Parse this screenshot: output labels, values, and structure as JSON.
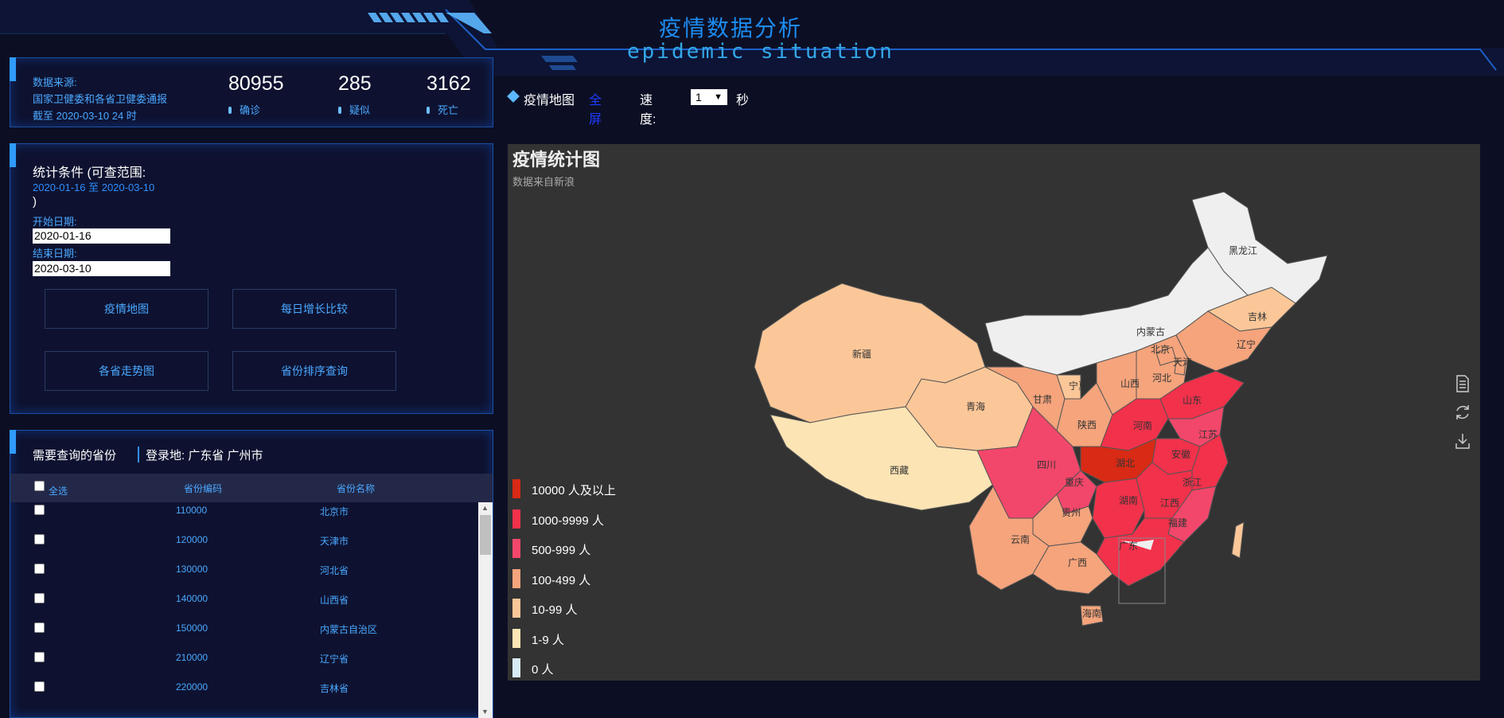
{
  "header": {
    "title_cn": "疫情数据分析",
    "title_en": "epidemic situation"
  },
  "summary": {
    "source_label": "数据来源:",
    "source_name": "国家卫健委和各省卫健委通报",
    "as_of": "截至 2020-03-10 24 时",
    "stats": [
      {
        "value": "80955",
        "label": "确诊"
      },
      {
        "value": "285",
        "label": "疑似"
      },
      {
        "value": "3162",
        "label": "死亡"
      }
    ]
  },
  "conditions": {
    "title": "统计条件 (可查范围:",
    "range": "2020-01-16 至 2020-03-10",
    "close": ")",
    "start_label": "开始日期:",
    "start_value": "2020-01-16",
    "end_label": "结束日期:",
    "end_value": "2020-03-10",
    "buttons": [
      "疫情地图",
      "每日增长比较",
      "各省走势图",
      "省份排序查询"
    ]
  },
  "query": {
    "title": "需要查询的省份",
    "login": "登录地: 广东省 广州市",
    "headers": {
      "all": "全选",
      "code": "省份编码",
      "name": "省份名称"
    },
    "rows": [
      {
        "code": "110000",
        "name": "北京市"
      },
      {
        "code": "120000",
        "name": "天津市"
      },
      {
        "code": "130000",
        "name": "河北省"
      },
      {
        "code": "140000",
        "name": "山西省"
      },
      {
        "code": "150000",
        "name": "内蒙古自治区"
      },
      {
        "code": "210000",
        "name": "辽宁省"
      },
      {
        "code": "220000",
        "name": "吉林省"
      }
    ]
  },
  "map_toolbar": {
    "title": "疫情地图",
    "fullscreen": "全屏",
    "speed_label": "速度:",
    "speed_value": "1",
    "unit": "秒"
  },
  "map": {
    "title": "疫情统计图",
    "subtitle": "数据来自新浪",
    "legend": [
      {
        "label": "10000 人及以上",
        "color": "#d82a14"
      },
      {
        "label": "1000-9999 人",
        "color": "#f2314b"
      },
      {
        "label": "500-999 人",
        "color": "#f2476a"
      },
      {
        "label": "100-499 人",
        "color": "#f5a47c"
      },
      {
        "label": "10-99 人",
        "color": "#fcc798"
      },
      {
        "label": "1-9 人",
        "color": "#fde4b4"
      },
      {
        "label": "0 人",
        "color": "#d8ecf6"
      }
    ],
    "province_labels": [
      "黑龙江",
      "吉林",
      "辽宁",
      "内蒙古",
      "北京",
      "天津",
      "河北",
      "山西",
      "宁夏",
      "甘肃",
      "新疆",
      "青海",
      "西藏",
      "陕西",
      "河南",
      "山东",
      "江苏",
      "安徽",
      "湖北",
      "四川",
      "重庆",
      "浙江",
      "湖南",
      "江西",
      "贵州",
      "福建",
      "云南",
      "广西",
      "广东",
      "海南"
    ],
    "tools": [
      "data-view-icon",
      "restore-icon",
      "save-image-icon"
    ]
  }
}
